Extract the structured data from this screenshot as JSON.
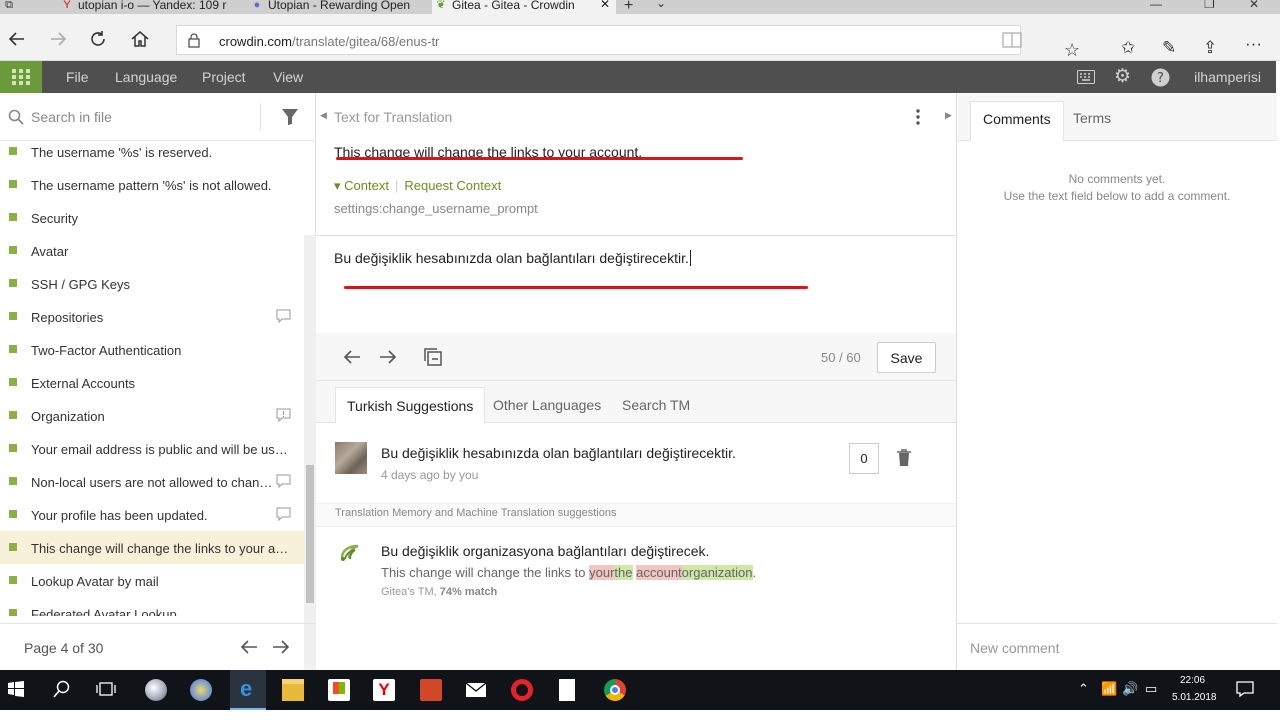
{
  "browser": {
    "tabs": [
      {
        "label": "utopian i-o — Yandex: 109 r",
        "active": false
      },
      {
        "label": "Utopian - Rewarding Open",
        "active": false
      },
      {
        "label": "Gitea - Gitea - Crowdin",
        "active": true
      }
    ],
    "url_host": "crowdin.com",
    "url_path": "/translate/gitea/68/enus-tr"
  },
  "app": {
    "menu": [
      "File",
      "Language",
      "Project",
      "View"
    ],
    "username": "ilhamperisi"
  },
  "left": {
    "search_placeholder": "Search in file",
    "strings": [
      {
        "text": "The username '%s' is reserved.",
        "comment": false,
        "selected": false
      },
      {
        "text": "The username pattern '%s' is not allowed.",
        "comment": false,
        "selected": false
      },
      {
        "text": "Security",
        "comment": false,
        "selected": false
      },
      {
        "text": "Avatar",
        "comment": false,
        "selected": false
      },
      {
        "text": "SSH / GPG Keys",
        "comment": false,
        "selected": false
      },
      {
        "text": "Repositories",
        "comment": true,
        "selected": false
      },
      {
        "text": "Two-Factor Authentication",
        "comment": false,
        "selected": false
      },
      {
        "text": "External Accounts",
        "comment": false,
        "selected": false
      },
      {
        "text": "Organization",
        "comment": true,
        "selected": false
      },
      {
        "text": "Your email address is public and will be used for any account-related notifications and any web based operations made via the site.",
        "comment": false,
        "selected": false
      },
      {
        "text": "Non-local users are not allowed to change their username.",
        "comment": true,
        "selected": false
      },
      {
        "text": "Your profile has been updated.",
        "comment": true,
        "selected": false
      },
      {
        "text": "This change will change the links to your account.",
        "comment": false,
        "selected": true
      },
      {
        "text": "Lookup Avatar by mail",
        "comment": false,
        "selected": false
      },
      {
        "text": "Federated Avatar Lookup",
        "comment": false,
        "selected": false
      }
    ],
    "page_label": "Page 4 of 30"
  },
  "center": {
    "source_header": "Text for Translation",
    "source_text": "This change will change the links to your account.",
    "context_label": "Context",
    "request_context_label": "Request Context",
    "context_key": "settings:change_username_prompt",
    "translation_text": "Bu değişiklik hesabınızda olan bağlantıları değiştirecektir.",
    "counter": "50 / 60",
    "save_label": "Save",
    "suggestion_tabs": [
      "Turkish Suggestions",
      "Other Languages",
      "Search TM"
    ],
    "suggestion": {
      "text": "Bu değişiklik hesabınızda olan bağlantıları değiştirecektir.",
      "meta": "4 days ago by you",
      "votes": "0"
    },
    "tm_header": "Translation Memory and Machine Translation suggestions",
    "tm": {
      "text": "Bu değişiklik organizasyona bağlantıları değiştirecek.",
      "diff_prefix": "This change will change the links to ",
      "diff_del1": "your",
      "diff_ins1": "the",
      "diff_space": " ",
      "diff_del2": "account",
      "diff_ins2": "organization",
      "diff_suffix": ".",
      "source": "Gitea's TM, ",
      "match": "74% match"
    }
  },
  "right": {
    "tabs": [
      "Comments",
      "Terms"
    ],
    "no_comments_1": "No comments yet.",
    "no_comments_2": "Use the text field below to add a comment.",
    "new_comment_placeholder": "New comment"
  },
  "taskbar": {
    "time": "22:06",
    "date": "5.01.2018"
  },
  "colors": {
    "accent_green": "#6a9a3a",
    "status_dot": "#8bb146",
    "header_bg": "#4f4f4f",
    "annotation_red": "#d9141c"
  }
}
